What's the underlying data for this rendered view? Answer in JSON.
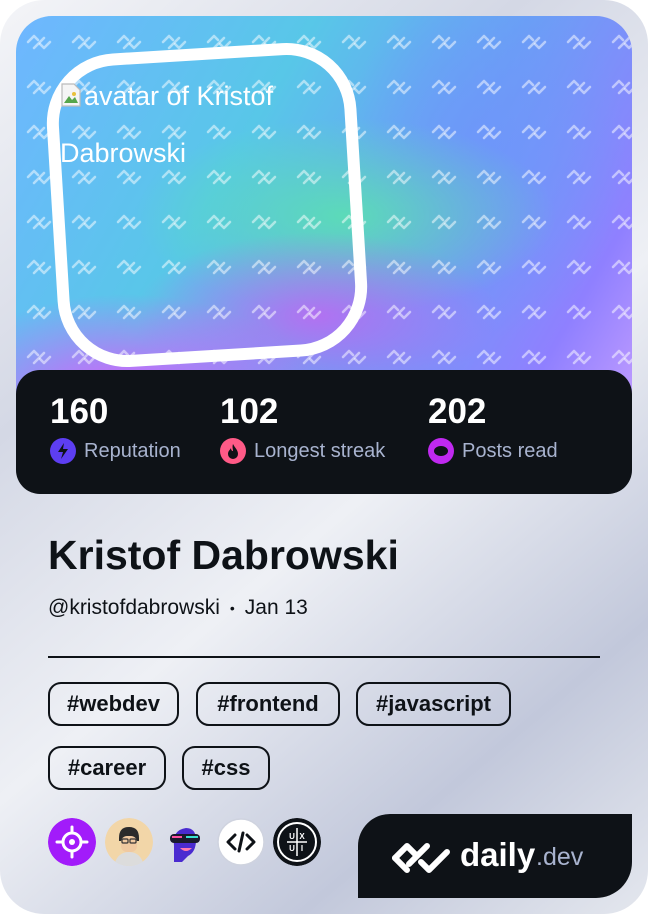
{
  "profile": {
    "avatar_alt": "avatar of Kristof Dabrowski",
    "name": "Kristof Dabrowski",
    "handle": "@kristofdabrowski",
    "separator": "•",
    "joined": "Jan 13"
  },
  "stats": [
    {
      "value": "160",
      "label": "Reputation",
      "icon": "bolt-icon",
      "color": "#5d3ef2"
    },
    {
      "value": "102",
      "label": "Longest streak",
      "icon": "flame-icon",
      "color": "#ff5a87"
    },
    {
      "value": "202",
      "label": "Posts read",
      "icon": "eye-icon",
      "color": "#c029f0"
    }
  ],
  "tags": [
    "#webdev",
    "#frontend",
    "#javascript",
    "#career",
    "#css"
  ],
  "badges": [
    "target-badge-icon",
    "user-avatar-badge",
    "robot-head-badge",
    "code-badge-icon",
    "ux-ui-badge-icon"
  ],
  "brand": {
    "daily": "daily",
    "dev": ".dev"
  },
  "colors": {
    "card_dark": "#0e1217",
    "label_gray": "#a8b3cf",
    "accent_purple": "#a21bfa"
  }
}
